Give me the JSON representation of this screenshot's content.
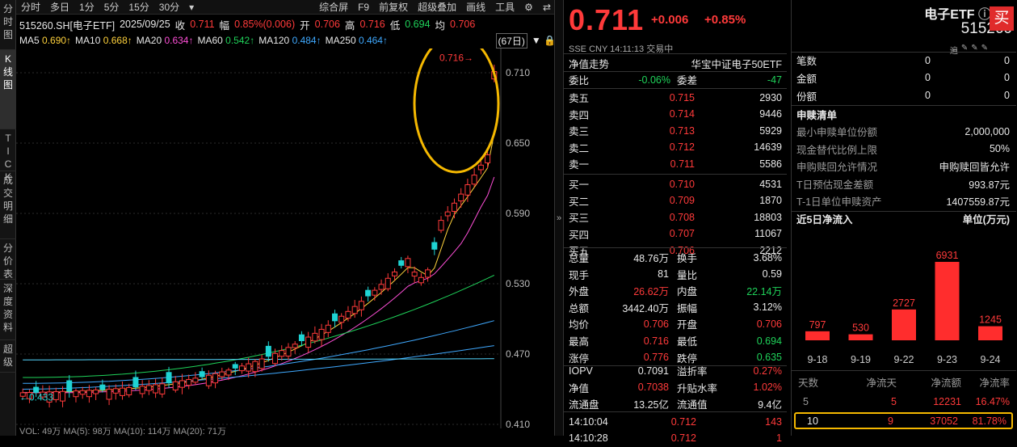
{
  "leftbar": [
    "分时图",
    "K线图",
    "TICK",
    "成交明细",
    "分价表",
    "深度资料",
    "超级"
  ],
  "toolbar": {
    "periods": [
      "分时",
      "多日",
      "1分",
      "5分",
      "15分",
      "30分"
    ],
    "dd": "▾",
    "tools": [
      "综合屏",
      "F9",
      "前复权",
      "超级叠加",
      "画线",
      "工具"
    ],
    "gear": "⚙",
    "arrow": "⇄"
  },
  "info": {
    "name": "515260.SH[电子ETF]",
    "date": "2025/09/25",
    "close_l": "收",
    "close": "0.711",
    "amp_l": "幅",
    "amp": "0.85%(0.006)",
    "open_l": "开",
    "open": "0.706",
    "high_l": "高",
    "high": "0.716",
    "low_l": "低",
    "low": "0.694",
    "avg_l": "均",
    "avg": "0.706"
  },
  "ma": [
    {
      "n": "MA5",
      "v": "0.690↑",
      "c": "#ffd23c"
    },
    {
      "n": "MA10",
      "v": "0.668↑",
      "c": "#ffd23c"
    },
    {
      "n": "MA20",
      "v": "0.634↑",
      "c": "#ff4fd8"
    },
    {
      "n": "MA60",
      "v": "0.542↑",
      "c": "#1fd35a"
    },
    {
      "n": "MA120",
      "v": "0.484↑",
      "c": "#3fa9ff"
    },
    {
      "n": "MA250",
      "v": "0.464↑",
      "c": "#3fa9ff"
    }
  ],
  "days": "(67日)",
  "vol": "VOL: 49万  MA(5): 98万  MA(10): 114万  MA(20): 71万",
  "quote": {
    "price": "0.711",
    "chg": "+0.006",
    "chgp": "+0.85%",
    "ex": "SSE   CNY   14:11:13   交易中",
    "nav_l": "净值走势",
    "index": "华宝中证电子50ETF",
    "wb_l": "委比",
    "wb": "-0.06%",
    "wc_l": "委差",
    "wc": "-47",
    "asks": [
      {
        "l": "卖五",
        "p": "0.715",
        "v": "2930"
      },
      {
        "l": "卖四",
        "p": "0.714",
        "v": "9446"
      },
      {
        "l": "卖三",
        "p": "0.713",
        "v": "5929"
      },
      {
        "l": "卖二",
        "p": "0.712",
        "v": "14639"
      },
      {
        "l": "卖一",
        "p": "0.711",
        "v": "5586"
      }
    ],
    "bids": [
      {
        "l": "买一",
        "p": "0.710",
        "v": "4531"
      },
      {
        "l": "买二",
        "p": "0.709",
        "v": "1870"
      },
      {
        "l": "买三",
        "p": "0.708",
        "v": "18803"
      },
      {
        "l": "买四",
        "p": "0.707",
        "v": "11067"
      },
      {
        "l": "买五",
        "p": "0.706",
        "v": "2212"
      }
    ],
    "stats": [
      {
        "a": "总量",
        "av": "48.76万",
        "ac": "wht",
        "b": "换手",
        "bv": "3.68%",
        "bc": "wht"
      },
      {
        "a": "现手",
        "av": "81",
        "ac": "wht",
        "b": "量比",
        "bv": "0.59",
        "bc": "wht"
      },
      {
        "a": "外盘",
        "av": "26.62万",
        "ac": "red",
        "b": "内盘",
        "bv": "22.14万",
        "bc": "green"
      },
      {
        "a": "总额",
        "av": "3442.40万",
        "ac": "wht",
        "b": "振幅",
        "bv": "3.12%",
        "bc": "wht"
      },
      {
        "a": "均价",
        "av": "0.706",
        "ac": "red",
        "b": "开盘",
        "bv": "0.706",
        "bc": "red"
      },
      {
        "a": "最高",
        "av": "0.716",
        "ac": "red",
        "b": "最低",
        "bv": "0.694",
        "bc": "green"
      },
      {
        "a": "涨停",
        "av": "0.776",
        "ac": "red",
        "b": "跌停",
        "bv": "0.635",
        "bc": "green"
      }
    ],
    "iopv": [
      {
        "a": "IOPV",
        "av": "0.7091",
        "ac": "wht",
        "b": "溢折率",
        "bv": "0.27%",
        "bc": "red"
      },
      {
        "a": "净值",
        "av": "0.7038",
        "ac": "red",
        "b": "升贴水率",
        "bv": "1.02%",
        "bc": "red"
      },
      {
        "a": "流通盘",
        "av": "13.25亿",
        "ac": "wht",
        "b": "流通值",
        "bv": "9.4亿",
        "bc": "wht"
      }
    ],
    "ticks": [
      {
        "t": "14:10:04",
        "p": "0.712",
        "v": "143"
      },
      {
        "t": "14:10:28",
        "p": "0.712",
        "v": "1"
      }
    ]
  },
  "right": {
    "title": "电子ETF",
    "info_icon": "ⓘ",
    "code": "515260",
    "buy": "买",
    "small_icons": [
      "遍",
      "✎",
      "✎",
      "✎"
    ],
    "top": [
      {
        "l": "笔数",
        "a": "0",
        "b": "0"
      },
      {
        "l": "金额",
        "a": "0",
        "b": "0"
      },
      {
        "l": "份额",
        "a": "0",
        "b": "0"
      }
    ],
    "sg_title": "申赎清单",
    "sg": [
      {
        "l": "最小申赎单位份额",
        "v": "2,000,000"
      },
      {
        "l": "现金替代比例上限",
        "v": "50%"
      },
      {
        "l": "申购赎回允许情况",
        "v": "申购赎回皆允许"
      },
      {
        "l": "T日预估现金差额",
        "v": "993.87元"
      },
      {
        "l": "T-1日单位申赎资产",
        "v": "1407559.87元"
      }
    ],
    "flow_title": "近5日净流入",
    "unit": "单位(万元)",
    "th": [
      "天数",
      "净流天",
      "净流额",
      "净流率"
    ],
    "tr": [
      [
        "5",
        "5",
        "12231",
        "16.47%"
      ],
      [
        "10",
        "9",
        "37052",
        "81.78%"
      ]
    ]
  },
  "chart_data": {
    "type": "bar",
    "categories": [
      "9-18",
      "9-19",
      "9-22",
      "9-23",
      "9-24"
    ],
    "values": [
      797,
      530,
      2727,
      6931,
      1245
    ],
    "ylim": [
      0,
      7500
    ]
  },
  "kline": {
    "price_ticks": [
      "0.710",
      "0.650",
      "0.590",
      "0.530",
      "0.470",
      "0.410"
    ],
    "hi_label": "0.716",
    "lo_label": "0.433",
    "colors": {
      "up": "#ff3a3a",
      "down": "#1fd3d3",
      "ring": "#f5b800"
    }
  }
}
